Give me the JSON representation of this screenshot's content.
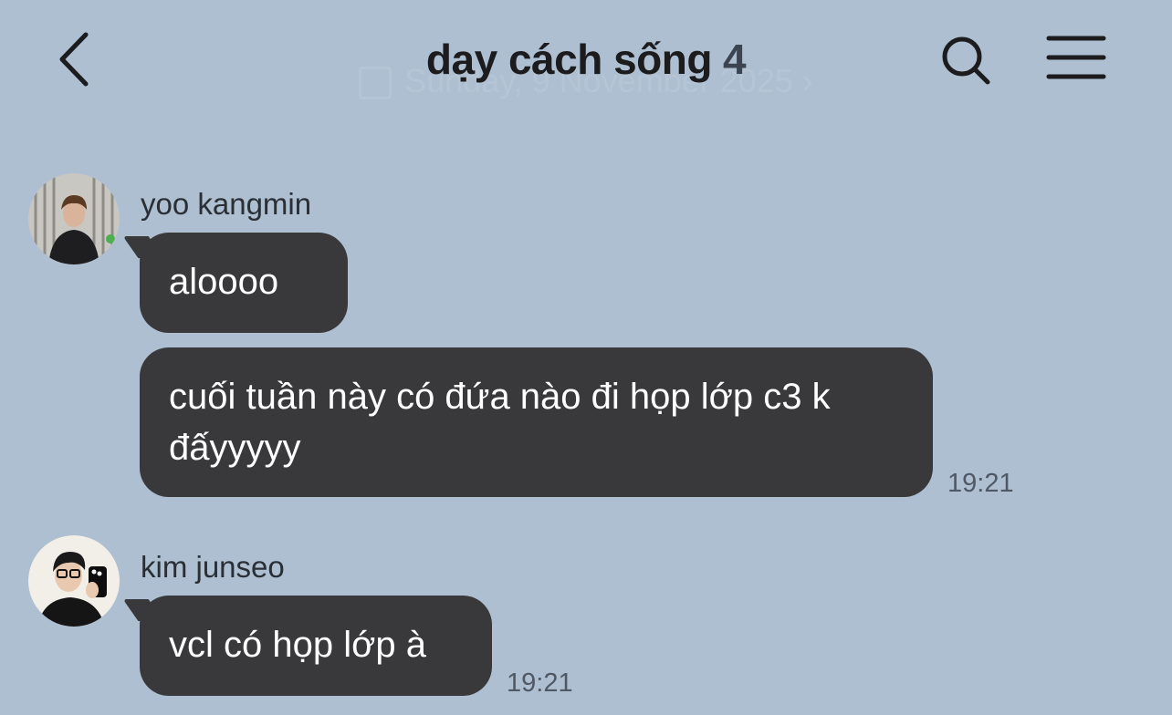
{
  "header": {
    "title": "dạy cách sống",
    "member_count": "4",
    "date_banner": "Sunday, 9 November 2025 ›"
  },
  "icons": {
    "back": "chevron-left-icon",
    "search": "search-icon",
    "menu": "hamburger-menu-icon"
  },
  "colors": {
    "background": "#adbfd0",
    "bubble": "#39393b",
    "bubble_text": "#ffffff"
  },
  "messages": [
    {
      "sender": "yoo kangmin",
      "texts": [
        "aloooo",
        "cuối tuần này có đứa nào đi họp lớp c3 k đấyyyyy"
      ],
      "time": "19:21"
    },
    {
      "sender": "kim junseo",
      "texts": [
        "vcl có họp lớp à"
      ],
      "time": "19:21"
    }
  ]
}
